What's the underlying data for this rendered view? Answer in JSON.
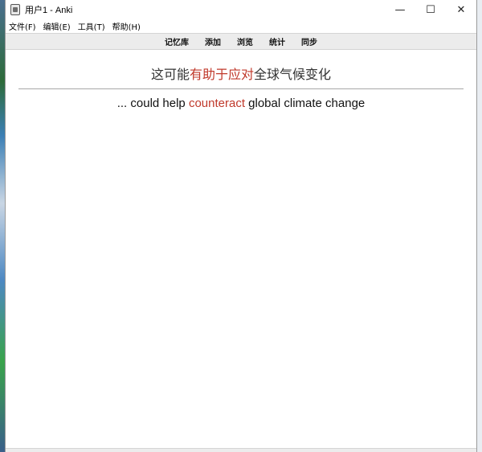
{
  "window": {
    "title": "用户1 - Anki",
    "controls": {
      "minimize": "—",
      "maximize": "☐",
      "close": "✕"
    }
  },
  "menu": {
    "items": [
      {
        "label": "文件(F)"
      },
      {
        "label": "编辑(E)"
      },
      {
        "label": "工具(T)"
      },
      {
        "label": "帮助(H)"
      }
    ]
  },
  "toolbar": {
    "links": [
      {
        "label": "记忆库"
      },
      {
        "label": "添加"
      },
      {
        "label": "浏览"
      },
      {
        "label": "统计"
      },
      {
        "label": "同步"
      }
    ]
  },
  "card": {
    "front": {
      "before": "这可能",
      "highlight": "有助于应对",
      "after": "全球气候变化"
    },
    "back": {
      "before": "... could help ",
      "highlight": "counteract",
      "after": " global climate change"
    }
  },
  "colors": {
    "highlight": "#c0392b",
    "toolbar_bg": "#ececec"
  }
}
